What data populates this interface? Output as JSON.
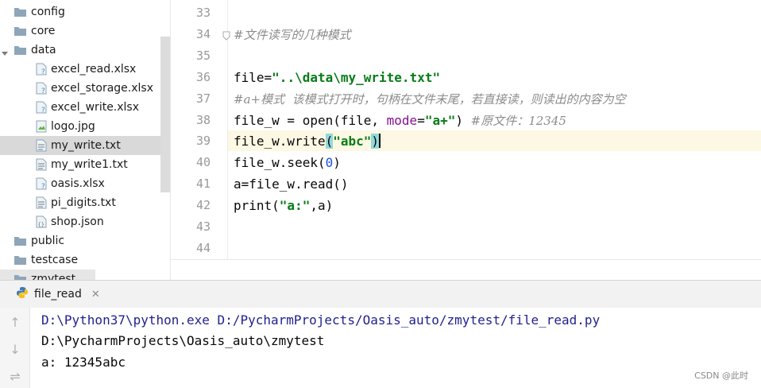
{
  "project_tree": {
    "items": [
      {
        "label": "config",
        "type": "folder"
      },
      {
        "label": "core",
        "type": "folder"
      },
      {
        "label": "data",
        "type": "folder"
      },
      {
        "label": "excel_read.xlsx",
        "type": "unknown-file"
      },
      {
        "label": "excel_storage.xlsx",
        "type": "unknown-file"
      },
      {
        "label": "excel_write.xlsx",
        "type": "unknown-file"
      },
      {
        "label": "logo.jpg",
        "type": "image-file"
      },
      {
        "label": "my_write.txt",
        "type": "text-file"
      },
      {
        "label": "my_write1.txt",
        "type": "text-file"
      },
      {
        "label": "oasis.xlsx",
        "type": "unknown-file"
      },
      {
        "label": "pi_digits.txt",
        "type": "text-file"
      },
      {
        "label": "shop.json",
        "type": "json-file"
      },
      {
        "label": "public",
        "type": "folder"
      },
      {
        "label": "testcase",
        "type": "folder"
      },
      {
        "label": "zmytest",
        "type": "folder"
      }
    ],
    "selected": "my_write.txt"
  },
  "editor": {
    "line_numbers": [
      "33",
      "34",
      "35",
      "36",
      "37",
      "38",
      "39",
      "40",
      "41",
      "42",
      "43",
      "44"
    ],
    "lines": {
      "l34": "#文件读写的几种模式",
      "l36_a": "file=",
      "l36_b": "\"..\\data\\my_write.txt\"",
      "l37": "#a+模式  该模式打开时，句柄在文件末尾，若直接读，则读出的内容为空",
      "l38_a": "file_w = open(file, ",
      "l38_b": "mode",
      "l38_c": "=",
      "l38_d": "\"a+\"",
      "l38_e": ") ",
      "l38_f": "#原文件：12345",
      "l39_a": "file_w.write",
      "l39_b": "(",
      "l39_c": "\"abc\"",
      "l39_d": ")",
      "l40_a": "file_w.seek(",
      "l40_b": "0",
      "l40_c": ")",
      "l41": "a=file_w.read()",
      "l42_a": "print(",
      "l42_b": "\"a:\"",
      "l42_c": ",a)"
    }
  },
  "run_panel": {
    "tab_label": "file_read",
    "close_glyph": "✕",
    "output": [
      "D:\\Python37\\python.exe D:/PycharmProjects/Oasis_auto/zmytest/file_read.py",
      "D:\\PycharmProjects\\Oasis_auto\\zmytest",
      "a: 12345abc"
    ],
    "side_buttons": {
      "up": "↑",
      "down": "↓",
      "wrap": "⇌"
    }
  },
  "watermark": "CSDN @此时",
  "colors": {
    "selection": "#d9d9d9",
    "current_line": "#fdf8e3",
    "string": "#067d17",
    "comment": "#8c8c8c",
    "number": "#1750eb",
    "keyword_arg": "#871094"
  }
}
